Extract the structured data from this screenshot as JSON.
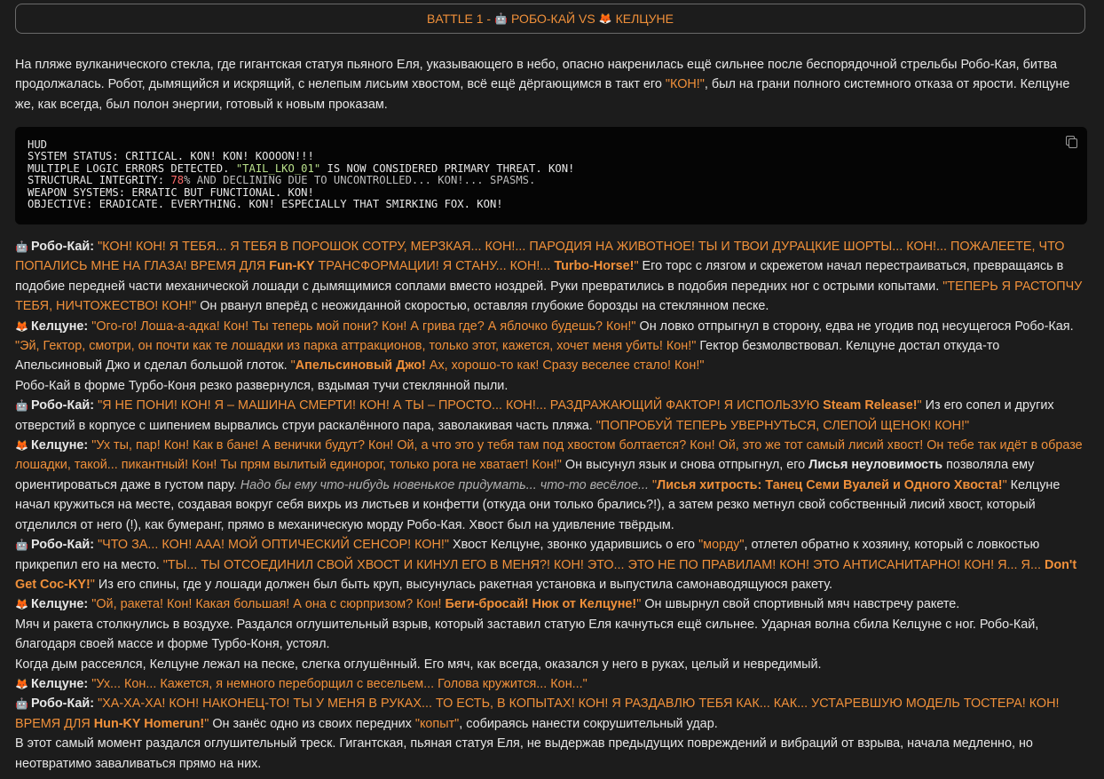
{
  "banner": {
    "prefix": "BATTLE 1 -",
    "left_emoji": "🤖",
    "left_name": "РОБО-КАЙ",
    "vs": "VS",
    "right_emoji": "🦊",
    "right_name": "КЕЛЦУНЕ"
  },
  "intro": {
    "part1": "На пляже вулканического стекла, где гигантская статуя пьяного Еля, указывающего в небо, опасно накренилась ещё сильнее после беспорядочной стрельбы Робо-Кая, битва продолжалась. Робот, дымящийся и искрящий, с нелепым лисьим хвостом, всё ещё дёргающимся в такт его ",
    "quote": "\"КОН!\"",
    "part2": ", был на грани полного системного отказа от ярости. Келцуне же, как всегда, был полон энергии, готовый к новым проказам."
  },
  "hud": {
    "l1": "HUD",
    "l2": "SYSTEM STATUS: CRITICAL. KON! KON! KOOOON!!!",
    "l3a": "MULTIPLE LOGIC ERRORS DETECTED. ",
    "l3b": "\"TAIL_LKO_01\"",
    "l3c": " IS NOW CONSIDERED PRIMARY THREAT. KON!",
    "l4a": "STRUCTURAL INTEGRITY: ",
    "l4b": "78",
    "l4c": "% AND DECLINING DUE TO UNCONTROLLED... KON!... SPASMS.",
    "l5": "WEAPON SYSTEMS: ERRATIC BUT FUNCTIONAL. KON!",
    "l6": "OBJECTIVE: ERADICATE. EVERYTHING. KON! ESPECIALLY THAT SMIRKING FOX. KON!"
  },
  "speakers": {
    "robo": "Робо-Кай:",
    "kel": "Келцуне:",
    "robo_emoji": "🤖",
    "kel_emoji": "🦊"
  },
  "d": {
    "p1a": "\"КОН! КОН! Я ТЕБЯ... Я ТЕБЯ В ПОРОШОК СОТРУ, МЕРЗКАЯ... КОН!... ПАРОДИЯ НА ЖИВОТНОЕ! ТЫ И ТВОИ ДУРАЦКИЕ ШОРТЫ... КОН!... ПОЖАЛЕЕТЕ, ЧТО ПОПАЛИСЬ МНЕ НА ГЛАЗА! ВРЕМЯ ДЛЯ ",
    "p1b": "Fun-KY",
    "p1c": " ТРАНСФОРМАЦИИ! Я СТАНУ... КОН!... ",
    "p1d": "Turbo-Horse!",
    "p1e": "\"",
    "p1f": " Его торс с лязгом и скрежетом начал перестраиваться, превращаясь в подобие передней части механической лошади с дымящимися соплами вместо ноздрей. Руки превратились в подобия передних ног с острыми копытами. ",
    "p1g": "\"ТЕПЕРЬ Я РАСТОПЧУ ТЕБЯ, НИЧТОЖЕСТВО! КОН!\"",
    "p1h": " Он рванул вперёд с неожиданной скоростью, оставляя глубокие борозды на стеклянном песке.",
    "p2a": "\"Ого-го! Лоша-а-адка! Кон! Ты теперь мой пони? Кон! А грива где? А яблочко будешь? Кон!\"",
    "p2b": " Он ловко отпрыгнул в сторону, едва не угодив под несущегося Робо-Кая. ",
    "p2c": "\"Эй, Гектор, смотри, он почти как те лошадки из парка аттракционов, только этот, кажется, хочет меня убить! Кон!\"",
    "p2d": " Гектор безмолвствовал. Келцуне достал откуда-то Апельсиновый Джо и сделал большой глоток. ",
    "p2e": "\"",
    "p2f": "Апельсиновый Джо!",
    "p2g": " Ах, хорошо-то как! Сразу веселее стало! Кон!\"",
    "p3": "Робо-Кай в форме Турбо-Коня резко развернулся, вздымая тучи стеклянной пыли.",
    "p4a": "\"Я НЕ ПОНИ! КОН! Я – МАШИНА СМЕРТИ! КОН! А ТЫ – ПРОСТО... КОН!... РАЗДРАЖАЮЩИЙ ФАКТОР! Я ИСПОЛЬЗУЮ ",
    "p4b": "Steam Release!",
    "p4c": "\"",
    "p4d": " Из его сопел и других отверстий в корпусе с шипением вырвались струи раскалённого пара, заволакивая часть пляжа. ",
    "p4e": "\"ПОПРОБУЙ ТЕПЕРЬ УВЕРНУТЬСЯ, СЛЕПОЙ ЩЕНОК! КОН!\"",
    "p5a": "\"Ух ты, пар! Кон! Как в бане! А венички будут? Кон! Ой, а что это у тебя там под хвостом болтается? Кон! Ой, это же тот самый лисий хвост! Он тебе так идёт в образе лошадки, такой... пикантный! Кон! Ты прям вылитый единорог, только рога не хватает! Кон!\"",
    "p5b": " Он высунул язык и снова отпрыгнул, его ",
    "p5c": "Лисья неуловимость",
    "p5d": " позволяла ему ориентироваться даже в густом пару. ",
    "p5e": "Надо бы ему что-нибудь новенькое придумать... что-то весёлое...",
    "p5f": " \"",
    "p5g": "Лисья хитрость: Танец Семи Вуалей и Одного Хвоста!",
    "p5h": "\"",
    "p5i": " Келцуне начал кружиться на месте, создавая вокруг себя вихрь из листьев и конфетти (откуда они только брались?!), а затем резко метнул свой собственный лисий хвост, который отделился от него (!), как бумеранг, прямо в механическую морду Робо-Кая. Хвост был на удивление твёрдым.",
    "p6a": "\"ЧТО ЗА... КОН! ААА! МОЙ ОПТИЧЕСКИЙ СЕНСОР! КОН!\"",
    "p6b": " Хвост Келцуне, звонко ударившись о его ",
    "p6c": "\"морду\"",
    "p6d": ", отлетел обратно к хозяину, который с ловкостью прикрепил его на место. ",
    "p6e": "\"ТЫ... ТЫ ОТСОЕДИНИЛ СВОЙ ХВОСТ И КИНУЛ ЕГО В МЕНЯ?! КОН! ЭТО... ЭТО НЕ ПО ПРАВИЛАМ! КОН! ЭТО АНТИСАНИТАРНО! КОН! Я... Я... ",
    "p6f": "Don't Get Coc-KY!",
    "p6g": "\"",
    "p6h": " Из его спины, где у лошади должен был быть круп, высунулась ракетная установка и выпустила самонаводящуюся ракету.",
    "p7a": "\"Ой, ракета! Кон! Какая большая! А она с сюрпризом? Кон! ",
    "p7b": "Беги-бросай! Нюк от Келцуне!",
    "p7c": "\"",
    "p7d": " Он швырнул свой спортивный мяч навстречу ракете.",
    "p8": "Мяч и ракета столкнулись в воздухе. Раздался оглушительный взрыв, который заставил статую Еля качнуться ещё сильнее. Ударная волна сбила Келцуне с ног. Робо-Кай, благодаря своей массе и форме Турбо-Коня, устоял.",
    "p9": "Когда дым рассеялся, Келцуне лежал на песке, слегка оглушённый. Его мяч, как всегда, оказался у него в руках, целый и невредимый.",
    "p10": "\"Ух... Кон... Кажется, я немного переборщил с весельем... Голова кружится... Кон...\"",
    "p11a": "\"ХА-ХА-ХА! КОН! НАКОНЕЦ-ТО! ТЫ У МЕНЯ В РУКАХ... ТО ЕСТЬ, В КОПЫТАХ! КОН! Я РАЗДАВЛЮ ТЕБЯ КАК... КАК... УСТАРЕВШУЮ МОДЕЛЬ ТОСТЕРА! КОН! ВРЕМЯ ДЛЯ ",
    "p11b": "Hun-KY Homerun!",
    "p11c": "\"",
    "p11d": " Он занёс одно из своих передних ",
    "p11e": "\"копыт\"",
    "p11f": ", собираясь нанести сокрушительный удар.",
    "p12": "В этот самый момент раздался оглушительный треск. Гигантская, пьяная статуя Еля, не выдержав предыдущих повреждений и вибраций от взрыва, начала медленно, но неотвратимо заваливаться прямо на них."
  }
}
